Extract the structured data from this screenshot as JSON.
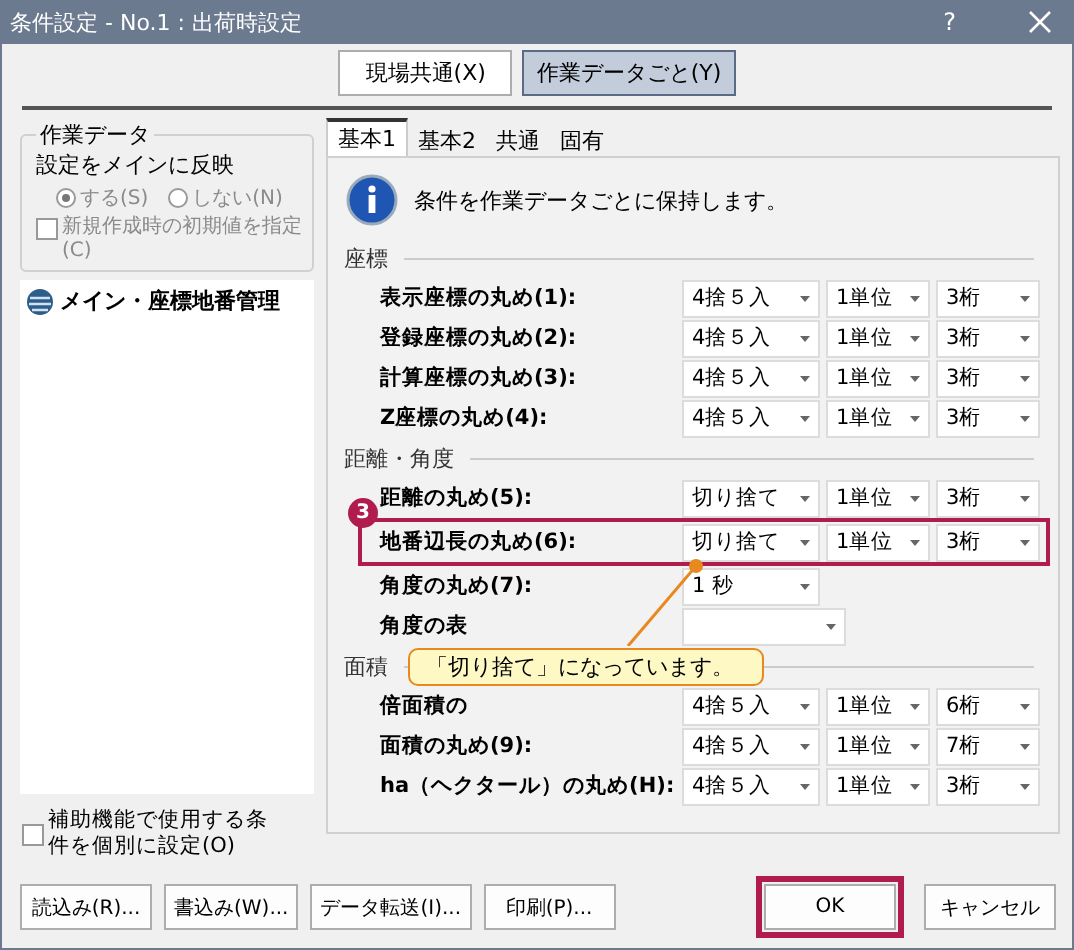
{
  "window": {
    "title": "条件設定 - No.1 : 出荷時設定",
    "help": "?"
  },
  "scope_buttons": [
    {
      "label": "現場共通(X)",
      "selected": false
    },
    {
      "label": "作業データごと(Y)",
      "selected": true
    }
  ],
  "work_data": {
    "legend": "作業データ",
    "label": "設定をメインに反映",
    "disabled": true,
    "options": [
      {
        "label": "する(S)",
        "selected": true
      },
      {
        "label": "しない(N)",
        "selected": false
      }
    ],
    "initial_checkbox": {
      "label": "新規作成時の初期値を指定(C)",
      "checked": false
    }
  },
  "tree": [
    {
      "label": "メイン・座標地番管理"
    }
  ],
  "helper_checkbox": {
    "label": "補助機能で使用する条件を個別に設定(O)",
    "checked": false
  },
  "tabs": [
    {
      "label": "基本1",
      "selected": true
    },
    {
      "label": "基本2",
      "selected": false
    },
    {
      "label": "共通",
      "selected": false
    },
    {
      "label": "固有",
      "selected": false
    }
  ],
  "info": "条件を作業データごとに保持します。",
  "sections": [
    {
      "title": "座標",
      "rows": [
        {
          "label": "表示座標の丸め(1):",
          "selects": [
            {
              "value": "4捨５入"
            },
            {
              "value": "1単位"
            },
            {
              "value": "3桁"
            }
          ]
        },
        {
          "label": "登録座標の丸め(2):",
          "selects": [
            {
              "value": "4捨５入"
            },
            {
              "value": "1単位"
            },
            {
              "value": "3桁"
            }
          ]
        },
        {
          "label": "計算座標の丸め(3):",
          "selects": [
            {
              "value": "4捨５入"
            },
            {
              "value": "1単位"
            },
            {
              "value": "3桁"
            }
          ]
        },
        {
          "label": " Z座標の丸め(4):",
          "selects": [
            {
              "value": "4捨５入"
            },
            {
              "value": "1単位"
            },
            {
              "value": "3桁"
            }
          ]
        }
      ]
    },
    {
      "title": "距離・角度",
      "rows": [
        {
          "label": "距離の丸め(5):",
          "selects": [
            {
              "value": "切り捨て"
            },
            {
              "value": "1単位"
            },
            {
              "value": "3桁"
            }
          ]
        },
        {
          "label": "地番辺長の丸め(6):",
          "highlighted": true,
          "step": "3",
          "selects": [
            {
              "value": "切り捨て"
            },
            {
              "value": "1単位"
            },
            {
              "value": "3桁"
            }
          ]
        },
        {
          "label": "角度の丸め(7):",
          "leader": true,
          "selects": [
            {
              "value": "1 秒"
            }
          ]
        },
        {
          "label": "角度の表",
          "callout": "「切り捨て」になっています。",
          "selects": [
            {
              "kind": "wide"
            }
          ]
        }
      ]
    },
    {
      "title": "面積",
      "rows": [
        {
          "label": "倍面積の",
          "selects": [
            {
              "value": "4捨５入"
            },
            {
              "value": "1単位"
            },
            {
              "value": "6桁"
            }
          ]
        },
        {
          "label": "面積の丸め(9):",
          "selects": [
            {
              "value": "4捨５入"
            },
            {
              "value": "1単位"
            },
            {
              "value": "7桁"
            }
          ]
        },
        {
          "label": "ha（ヘクタール）の丸め(H):",
          "selects": [
            {
              "value": "4捨５入"
            },
            {
              "value": "1単位"
            },
            {
              "value": "3桁"
            }
          ]
        }
      ]
    }
  ],
  "bottom_buttons": [
    "読込み(R)...",
    "書込み(W)...",
    "データ転送(I)...",
    "印刷(P)..."
  ],
  "dialog_buttons": [
    {
      "label": "OK",
      "highlighted": true
    },
    {
      "label": "キャンセル",
      "highlighted": false
    }
  ]
}
